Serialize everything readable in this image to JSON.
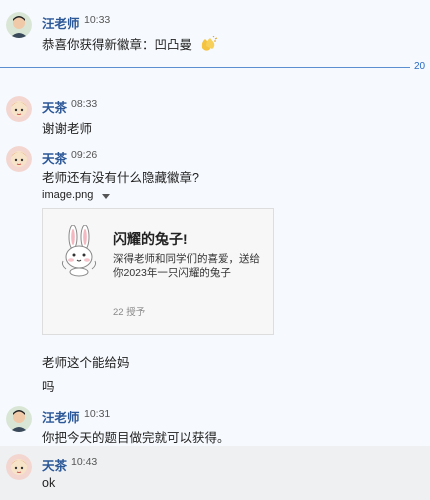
{
  "messages": [
    {
      "name": "汪老师",
      "time": "10:33",
      "text": "恭喜你获得新徽章：凹凸曼"
    },
    {
      "name": "天茶",
      "time": "08:33",
      "text": "谢谢老师"
    },
    {
      "name": "天茶",
      "time": "09:26",
      "text": "老师还有没有什么隐藏徽章?"
    },
    {
      "name": "汪老师",
      "time": "10:31",
      "text": "你把今天的题目做完就可以获得。"
    },
    {
      "name": "天茶",
      "time": "10:43",
      "text": "ok"
    }
  ],
  "divider_label": "20",
  "attachment": {
    "filename": "image.png"
  },
  "badge_card": {
    "title": "闪耀的兔子!",
    "desc": "深得老师和同学们的喜爱，送给你2023年一只闪耀的兔子",
    "count": "22 授予"
  },
  "extra_lines": [
    "老师这个能给妈",
    "吗"
  ],
  "colors": {
    "name": "#2b5797",
    "divider": "#5b8fd0",
    "background": "#f6f9fd"
  }
}
